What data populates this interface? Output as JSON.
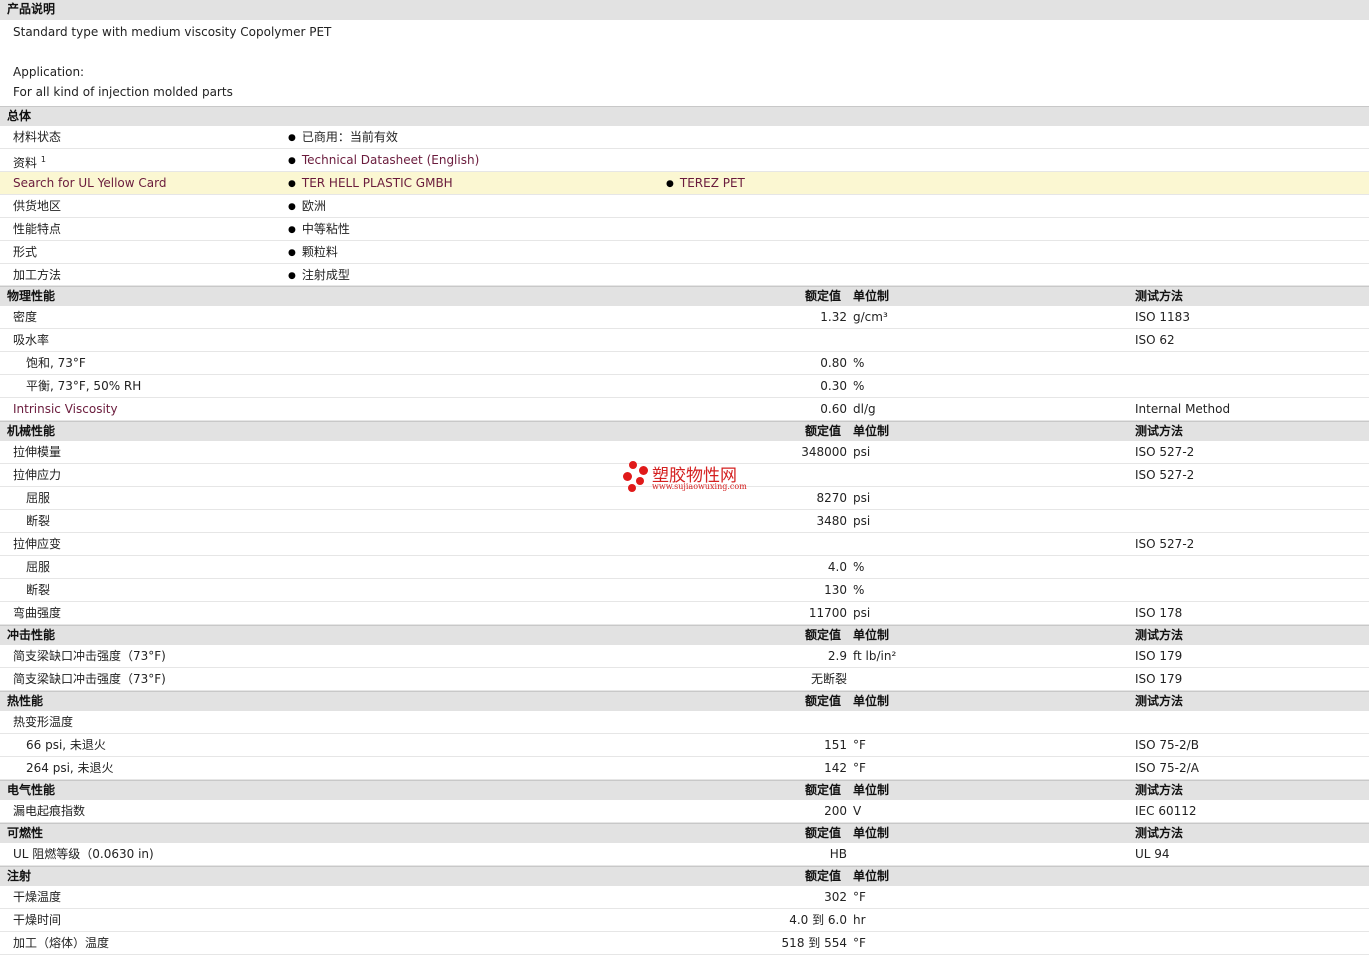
{
  "product_description": {
    "title": "产品说明",
    "line1": "Standard type with medium viscosity Copolymer PET",
    "line2": "",
    "line3": "Application:",
    "line4": "For all kind of injection molded parts"
  },
  "general": {
    "title": "总体",
    "material_status_label": "材料状态",
    "material_status_value": "已商用：当前有效",
    "docs_label": "资料",
    "docs_sup": "1",
    "docs_link": "Technical Datasheet (English)",
    "ul_label": "Search for UL Yellow Card",
    "ul_link1": "TER HELL PLASTIC GMBH",
    "ul_link2": "TEREZ PET",
    "region_label": "供货地区",
    "region_value": "欧洲",
    "features_label": "性能特点",
    "features_value": "中等粘性",
    "form_label": "形式",
    "form_value": "颗粒料",
    "processing_label": "加工方法",
    "processing_value": "注射成型"
  },
  "headers": {
    "nominal": "额定值",
    "unit": "单位制",
    "test": "测试方法"
  },
  "physical": {
    "title": "物理性能",
    "rows": [
      {
        "name": "密度",
        "value": "1.32",
        "unit": "g/cm³",
        "test": "ISO 1183"
      },
      {
        "name": "吸水率",
        "value": "",
        "unit": "",
        "test": "ISO 62"
      },
      {
        "name": "饱和, 73°F",
        "value": "0.80",
        "unit": "%",
        "test": ""
      },
      {
        "name": "平衡, 73°F, 50% RH",
        "value": "0.30",
        "unit": "%",
        "test": ""
      },
      {
        "name": "Intrinsic Viscosity",
        "value": "0.60",
        "unit": "dl/g",
        "test": "Internal Method"
      }
    ]
  },
  "mechanical": {
    "title": "机械性能",
    "rows": [
      {
        "name": "拉伸模量",
        "value": "348000",
        "unit": "psi",
        "test": "ISO 527-2"
      },
      {
        "name": "拉伸应力",
        "value": "",
        "unit": "",
        "test": "ISO 527-2"
      },
      {
        "name": "屈服",
        "value": "8270",
        "unit": "psi",
        "test": ""
      },
      {
        "name": "断裂",
        "value": "3480",
        "unit": "psi",
        "test": ""
      },
      {
        "name": "拉伸应变",
        "value": "",
        "unit": "",
        "test": "ISO 527-2"
      },
      {
        "name": "屈服",
        "value": "4.0",
        "unit": "%",
        "test": ""
      },
      {
        "name": "断裂",
        "value": "130",
        "unit": "%",
        "test": ""
      },
      {
        "name": "弯曲强度",
        "value": "11700",
        "unit": "psi",
        "test": "ISO 178"
      }
    ]
  },
  "impact": {
    "title": "冲击性能",
    "rows": [
      {
        "name": "简支梁缺口冲击强度（73°F)",
        "value": "2.9",
        "unit": "ft lb/in²",
        "test": "ISO 179"
      },
      {
        "name": "简支梁缺口冲击强度（73°F)",
        "value": "无断裂",
        "unit": "",
        "test": "ISO 179"
      }
    ]
  },
  "thermal": {
    "title": "热性能",
    "rows": [
      {
        "name": "热变形温度",
        "value": "",
        "unit": "",
        "test": ""
      },
      {
        "name": "66 psi, 未退火",
        "value": "151",
        "unit": "°F",
        "test": "ISO 75-2/B"
      },
      {
        "name": "264 psi, 未退火",
        "value": "142",
        "unit": "°F",
        "test": "ISO 75-2/A"
      }
    ]
  },
  "electrical": {
    "title": "电气性能",
    "rows": [
      {
        "name": "漏电起痕指数",
        "value": "200",
        "unit": "V",
        "test": "IEC 60112"
      }
    ]
  },
  "flammability": {
    "title": "可燃性",
    "rows": [
      {
        "name": "UL 阻燃等级（0.0630 in)",
        "value": "HB",
        "unit": "",
        "test": "UL 94"
      }
    ]
  },
  "injection": {
    "title": "注射",
    "rows": [
      {
        "name": "干燥温度",
        "value": "302",
        "unit": "°F",
        "test": ""
      },
      {
        "name": "干燥时间",
        "value": "4.0 到 6.0",
        "unit": "hr",
        "test": ""
      },
      {
        "name": "加工（熔体）温度",
        "value": "518 到 554",
        "unit": "°F",
        "test": ""
      }
    ]
  },
  "watermark": {
    "cn": "塑胶物性网",
    "url": "www.sujiaowuxing.com"
  },
  "colors": {
    "link": "#6a1b3c",
    "section_bg": "#e2e2e2",
    "highlight_row": "#fbf7d2",
    "watermark": "#d42020"
  }
}
